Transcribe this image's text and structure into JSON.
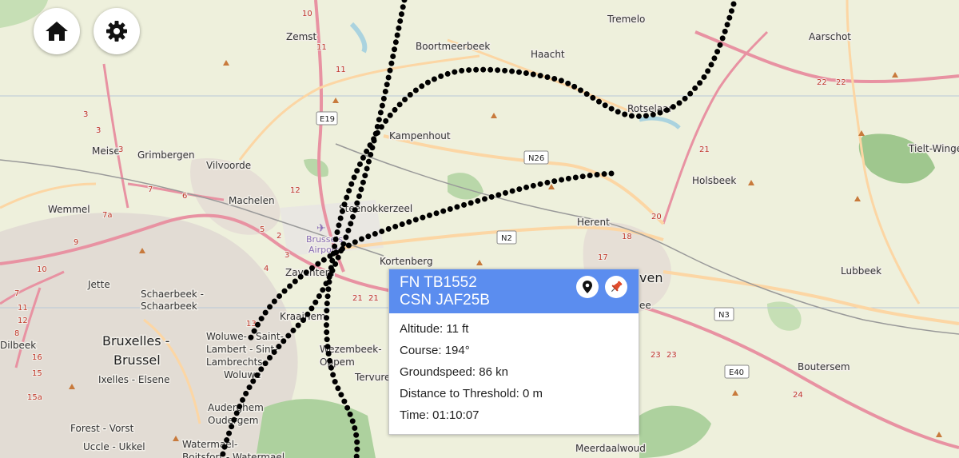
{
  "controls": {
    "home": "home-icon",
    "settings": "gear-icon"
  },
  "places": {
    "zemst": "Zemst",
    "boortmeerbeek": "Boortmeerbeek",
    "haacht": "Haacht",
    "tremelo": "Tremelo",
    "aarschot": "Aarschot",
    "rotselaar": "Rotselaar",
    "kampenhout": "Kampenhout",
    "meise": "Meise",
    "grimbergen": "Grimbergen",
    "vilvoorde": "Vilvoorde",
    "machelen": "Machelen",
    "wemmel": "Wemmel",
    "steenokkerzeel": "Steenokkerzeel",
    "brussels_airport_1": "Brussels",
    "brussels_airport_2": "Airport",
    "kortenberg": "Kortenberg",
    "zaventem": "Zaventem",
    "herent": "Herent",
    "holsbeek": "Holsbeek",
    "tielt_winge": "Tielt-Winge",
    "lubbeek": "Lubbeek",
    "leuven": "ven",
    "jette": "Jette",
    "schaerbeek1": "Schaerbeek -",
    "schaerbeek2": "Schaarbeek",
    "kraainem": "Kraainem",
    "bruxelles1": "Bruxelles -",
    "bruxelles2": "Brussel",
    "woluwe1": "Woluwe-",
    "woluwe2": "Lambert -",
    "woluwe3": "Lambrechts-",
    "woluwe4": "Woluwe",
    "woluwe_sint": "Saint-",
    "woluwe_sint2": "Sint-",
    "wezembeek1": "Wezembeek-",
    "wezembeek2": "Oppem",
    "ixelles": "Ixelles - Elsene",
    "dilbeek": "Dilbeek",
    "tervuren": "Tervuren",
    "auderghem1": "Auderghem",
    "auderghem2": "Oudergem",
    "forest": "Forest - Vorst",
    "uccle": "Uccle - Ukkel",
    "watermael1": "Watermael-",
    "watermael2": "Boitsfort - Watermael",
    "boutersem": "Boutersem",
    "meerdaal": "Meerdaalwoud",
    "leuven_part": "ee"
  },
  "roads": {
    "e19": "E19",
    "n26": "N26",
    "n2": "N2",
    "n3": "N3",
    "e40": "E40",
    "n10a": "10",
    "n11a": "11",
    "n11b": "11",
    "n3a": "3",
    "n3b": "3",
    "n3c": "3",
    "n7": "7",
    "n6": "6",
    "n7a": "7a",
    "n9": "9",
    "n12": "12",
    "n5": "5",
    "n2a": "2",
    "n3d": "3",
    "n4": "4",
    "n21a": "21",
    "n21b": "21",
    "n22a": "22",
    "n22b": "22",
    "n21c": "21",
    "n20": "20",
    "n18": "18",
    "n17": "17",
    "n23a": "23",
    "n23b": "23",
    "n24": "24",
    "n13": "13",
    "n15a": "15a",
    "n11c": "11",
    "n12b": "12",
    "n10b": "10",
    "n7b": "7",
    "n15b": "15",
    "n16": "16",
    "n8": "8"
  },
  "popup": {
    "line1": "FN TB1552",
    "line2": "CSN JAF25B",
    "altitude": "Altitude: 11 ft",
    "course": "Course: 194°",
    "groundspeed": "Groundspeed: 86 kn",
    "distance": "Distance to Threshold: 0 m",
    "time": "Time: 01:10:07",
    "locate_icon": "map-pin-icon",
    "pin_icon": "pushpin-icon",
    "header_color": "#5b8def"
  },
  "colors": {
    "track": "#000000",
    "motorway": "#e892a2",
    "primary": "#fcd6a4",
    "forest": "#add19e"
  }
}
